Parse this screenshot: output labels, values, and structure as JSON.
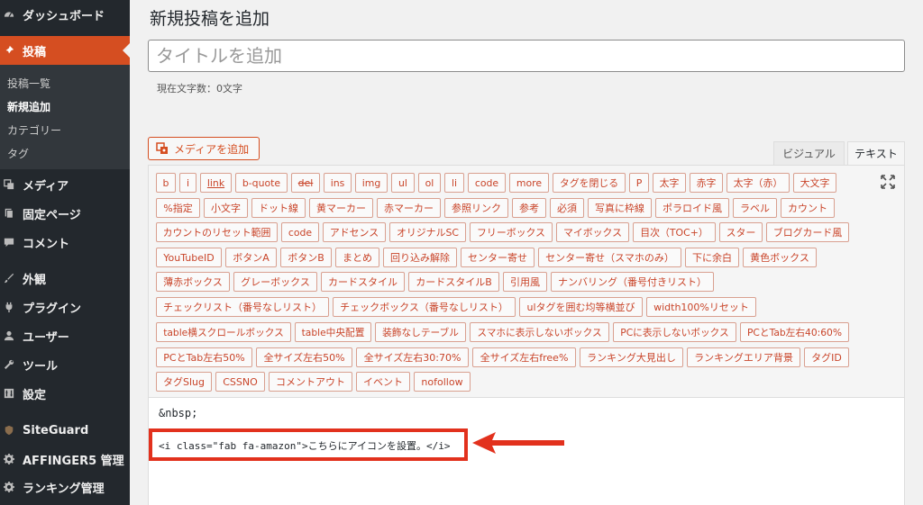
{
  "sidebar": {
    "items": [
      {
        "label": "ダッシュボード",
        "icon": "dashboard-icon"
      },
      {
        "label": "投稿",
        "icon": "pin-icon",
        "active": true
      },
      {
        "label": "メディア",
        "icon": "media-icon"
      },
      {
        "label": "固定ページ",
        "icon": "page-icon"
      },
      {
        "label": "コメント",
        "icon": "comment-icon"
      },
      {
        "label": "外観",
        "icon": "brush-icon"
      },
      {
        "label": "プラグイン",
        "icon": "plugin-icon"
      },
      {
        "label": "ユーザー",
        "icon": "user-icon"
      },
      {
        "label": "ツール",
        "icon": "wrench-icon"
      },
      {
        "label": "設定",
        "icon": "settings-icon"
      },
      {
        "label": "SiteGuard",
        "icon": "siteguard-icon"
      },
      {
        "label": "AFFINGER5 管理",
        "icon": "gear-icon"
      },
      {
        "label": "ランキング管理",
        "icon": "gear-icon"
      }
    ],
    "submenu": [
      "投稿一覧",
      "新規追加",
      "カテゴリー",
      "タグ"
    ]
  },
  "main": {
    "page_title": "新規投稿を追加",
    "title_placeholder": "タイトルを追加",
    "char_count": "現在文字数：0文字",
    "media_button": "メディアを追加",
    "tab_visual": "ビジュアル",
    "tab_text": "テキスト"
  },
  "quicktags": [
    [
      "b",
      "i",
      "link",
      "b-quote",
      "del",
      "ins",
      "img",
      "ul",
      "ol",
      "li",
      "code",
      "more",
      "タグを閉じる",
      "P",
      "太字",
      "赤字",
      "太字（赤）",
      "大文字"
    ],
    [
      "%指定",
      "小文字",
      "ドット線",
      "黄マーカー",
      "赤マーカー",
      "参照リンク",
      "参考",
      "必須",
      "写真に枠線",
      "ポラロイド風",
      "ラベル",
      "カウント"
    ],
    [
      "カウントのリセット範囲",
      "code",
      "アドセンス",
      "オリジナルSC",
      "フリーボックス",
      "マイボックス",
      "目次（TOC+）",
      "スター",
      "ブログカード風"
    ],
    [
      "YouTubeID",
      "ボタンA",
      "ボタンB",
      "まとめ",
      "回り込み解除",
      "センター寄せ",
      "センター寄せ（スマホのみ）",
      "下に余白",
      "黄色ボックス"
    ],
    [
      "薄赤ボックス",
      "グレーボックス",
      "カードスタイル",
      "カードスタイルB",
      "引用風",
      "ナンバリング（番号付きリスト）"
    ],
    [
      "チェックリスト（番号なしリスト）",
      "チェックボックス（番号なしリスト）",
      "ulタグを囲む均等横並び",
      "width100%リセット"
    ],
    [
      "table横スクロールボックス",
      "table中央配置",
      "装飾なしテーブル",
      "スマホに表示しないボックス",
      "PCに表示しないボックス",
      "PCとTab左右40:60%"
    ],
    [
      "PCとTab左右50%",
      "全サイズ左右50%",
      "全サイズ左右30:70%",
      "全サイズ左右free%",
      "ランキング大見出し",
      "ランキングエリア背景",
      "タグID"
    ],
    [
      "タグSlug",
      "CSSNO",
      "コメントアウト",
      "イベント",
      "nofollow"
    ]
  ],
  "editor": {
    "line1": "&nbsp;",
    "line2": "<i class=\"fab fa-amazon\">こちらにアイコンを設置。</i>"
  },
  "colors": {
    "sidebar_bg": "#23282d",
    "accent": "#d54e21",
    "highlight": "#e2311d"
  }
}
